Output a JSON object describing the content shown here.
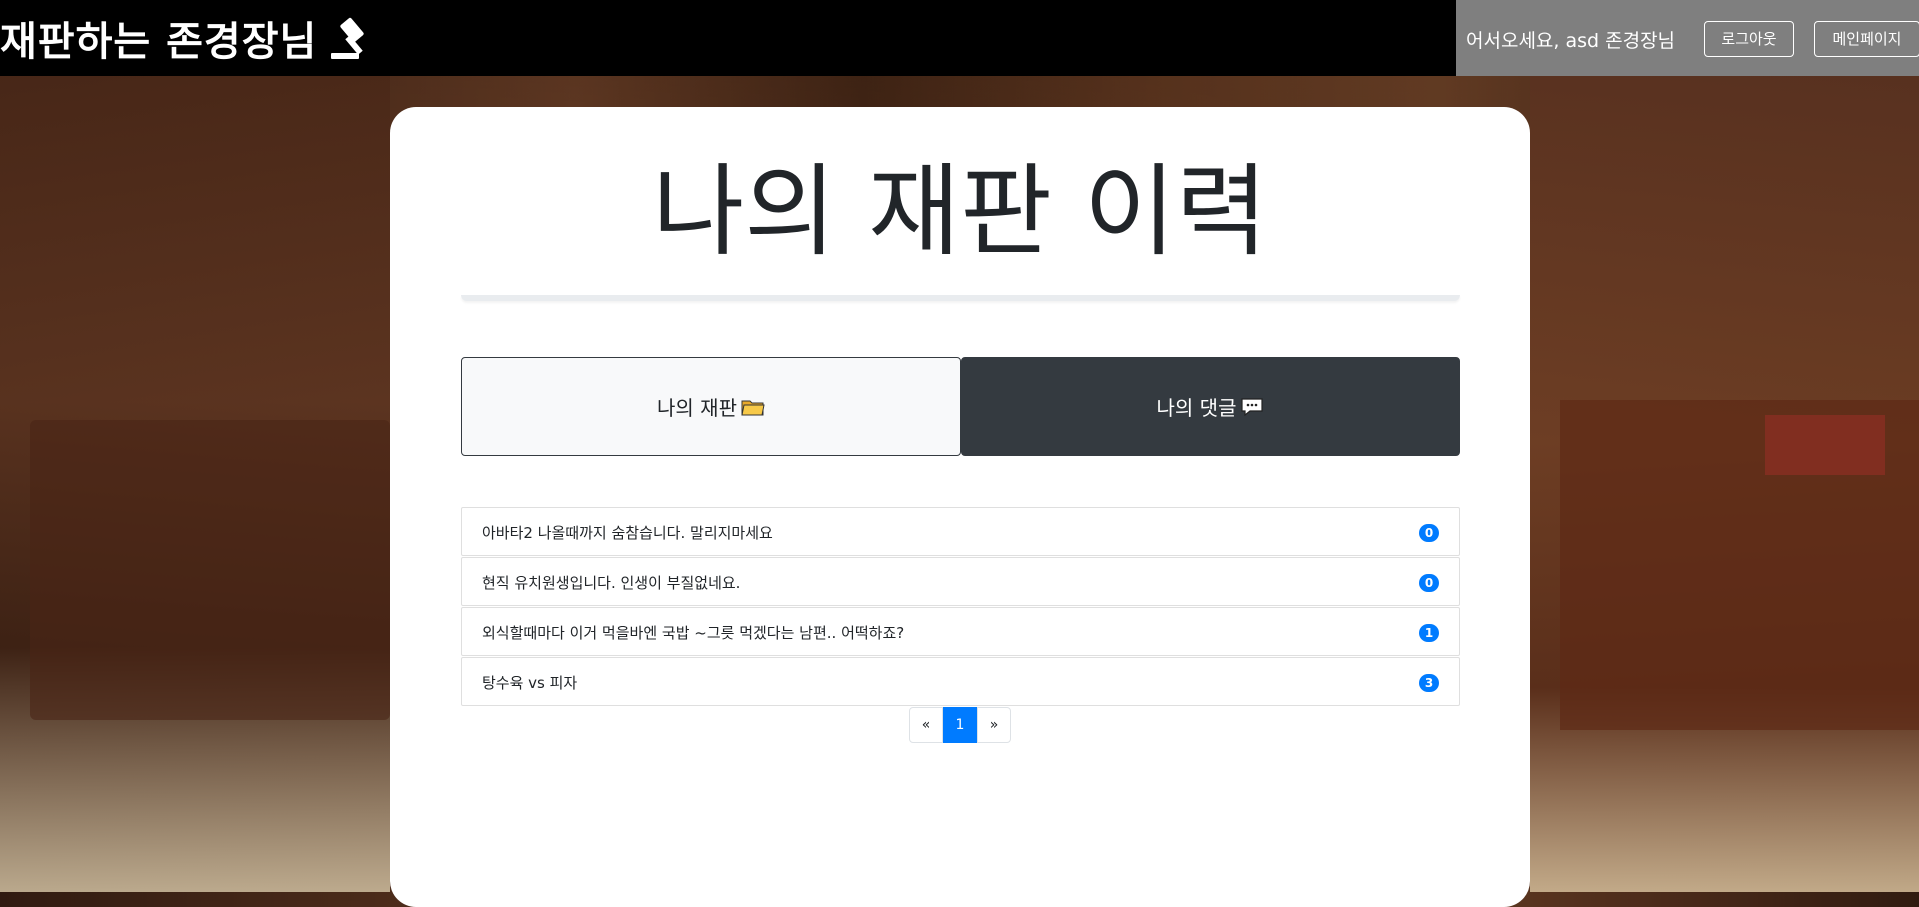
{
  "brand": {
    "title": "재판하는 존경장님",
    "icon": "gavel-icon"
  },
  "nav": {
    "welcome": "어서오세요, asd 존경장님",
    "logout_label": "로그아웃",
    "main_page_label": "메인페이지"
  },
  "page": {
    "title": "나의 재판 이력"
  },
  "tabs": [
    {
      "label": "나의 재판",
      "icon": "folder-icon",
      "active": false
    },
    {
      "label": "나의 댓글",
      "icon": "speech-bubble-icon",
      "active": true
    }
  ],
  "comments": [
    {
      "text": "아바타2 나올때까지 숨참습니다. 말리지마세요",
      "count": "0"
    },
    {
      "text": "현직 유치원생입니다. 인생이 부질없네요.",
      "count": "0"
    },
    {
      "text": "외식할때마다 이거 먹을바엔 국밥 ~그릇 먹겠다는 남편.. 어떡하죠?",
      "count": "1"
    },
    {
      "text": "탕수육 vs 피자",
      "count": "3"
    }
  ],
  "pagination": {
    "prev": "«",
    "current": "1",
    "next": "»"
  },
  "colors": {
    "accent": "#007bff",
    "dark_tab": "#343a40",
    "nav_bg": "#000000",
    "nav_right_bg": "#7f7f7f"
  }
}
